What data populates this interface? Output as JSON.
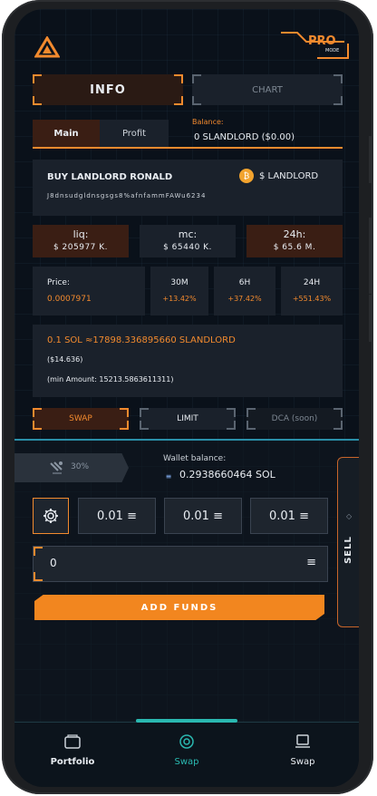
{
  "header": {
    "mode_label": "PRO",
    "mode_sub": "MODE"
  },
  "tabs": {
    "info": "INFO",
    "chart": "CHART"
  },
  "subtabs": {
    "main": "Main",
    "profit": "Profit"
  },
  "balance": {
    "label": "Balance:",
    "value": "0  SLANDLORD  ($0.00)"
  },
  "token": {
    "action": "BUY  LANDLORD RONALD",
    "symbol": "$ LANDLORD",
    "address": "J8dnsudgldnsgsgs8%afnfammFAWu6234"
  },
  "stats": [
    {
      "label": "liq:",
      "value": "$ 205977 K."
    },
    {
      "label": "mc:",
      "value": "$ 65440 K."
    },
    {
      "label": "24h:",
      "value": "$ 65.6 M."
    }
  ],
  "price": {
    "label": "Price:",
    "value": "0.0007971",
    "changes": [
      {
        "label": "30M",
        "value": "+13.42%"
      },
      {
        "label": "6H",
        "value": "+37.42%"
      },
      {
        "label": "24H",
        "value": "+551.43%"
      }
    ]
  },
  "quote": {
    "line": "0.1 SOL ≈17898.336895660 SLANDLORD",
    "usd": "($14.636)",
    "min": "(min Amount: 15213.5863611311)"
  },
  "order_types": {
    "swap": "SWAP",
    "limit": "LIMIT",
    "dca": "DCA (soon)"
  },
  "slippage": {
    "value": "30%"
  },
  "wallet": {
    "label": "Wallet balance:",
    "value": "0.2938660464 SOL"
  },
  "presets": [
    "0.01 ≡",
    "0.01 ≡",
    "0.01 ≡"
  ],
  "amount_input": {
    "value": "0"
  },
  "sell_label": "SELL",
  "add_funds": "ADD FUNDS",
  "nav": [
    {
      "label": "Portfolio",
      "icon": "wallet-icon",
      "active": false
    },
    {
      "label": "Swap",
      "icon": "swap-target-icon",
      "active": true
    },
    {
      "label": "Swap",
      "icon": "bucket-icon",
      "active": false
    }
  ],
  "colors": {
    "accent": "#f28a2e",
    "positive": "#f28a2e",
    "background": "#0a111a",
    "active_nav": "#2ab8b0"
  }
}
